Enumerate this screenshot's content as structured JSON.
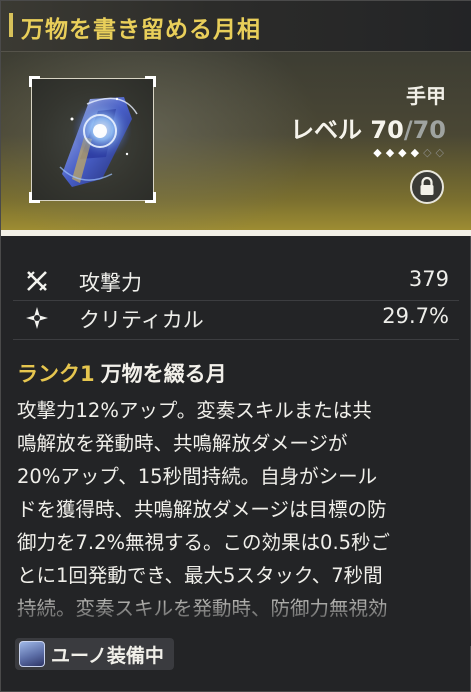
{
  "header": {
    "title": "万物を書き留める月相"
  },
  "item": {
    "slot_label": "手甲",
    "level_prefix": "レベル ",
    "level_current": "70",
    "level_separator": "/",
    "level_max": "70",
    "stars_filled": "◆◆◆◆",
    "stars_empty": "◇◇",
    "icon": "gauntlet-image",
    "lock_icon": "lock-icon"
  },
  "stats": [
    {
      "icon": "crossed-swords-icon",
      "name": "攻撃力",
      "value": "379"
    },
    {
      "icon": "crit-star-icon",
      "name": "クリティカル",
      "value": "29.7%"
    }
  ],
  "rank": {
    "tag": "ランク1",
    "name": "万物を綴る月"
  },
  "description": "攻撃力12%アップ。変奏スキルまたは共\n鳴解放を発動時、共鳴解放ダメージが\n20%アップ、15秒間持続。自身がシール\nドを獲得時、共鳴解放ダメージは目標の防\n御力を7.2%無視する。この効果は0.5秒ご\nとに1回発動でき、最大5スタック、7秒間\n持続。変奏スキルを発動時、防御力無視効",
  "equipped": {
    "label": "ユーノ装備中"
  },
  "colors": {
    "title": "#e9cf5a",
    "rank_tag": "#e6c64f",
    "hero_bottom": "#a49233"
  }
}
